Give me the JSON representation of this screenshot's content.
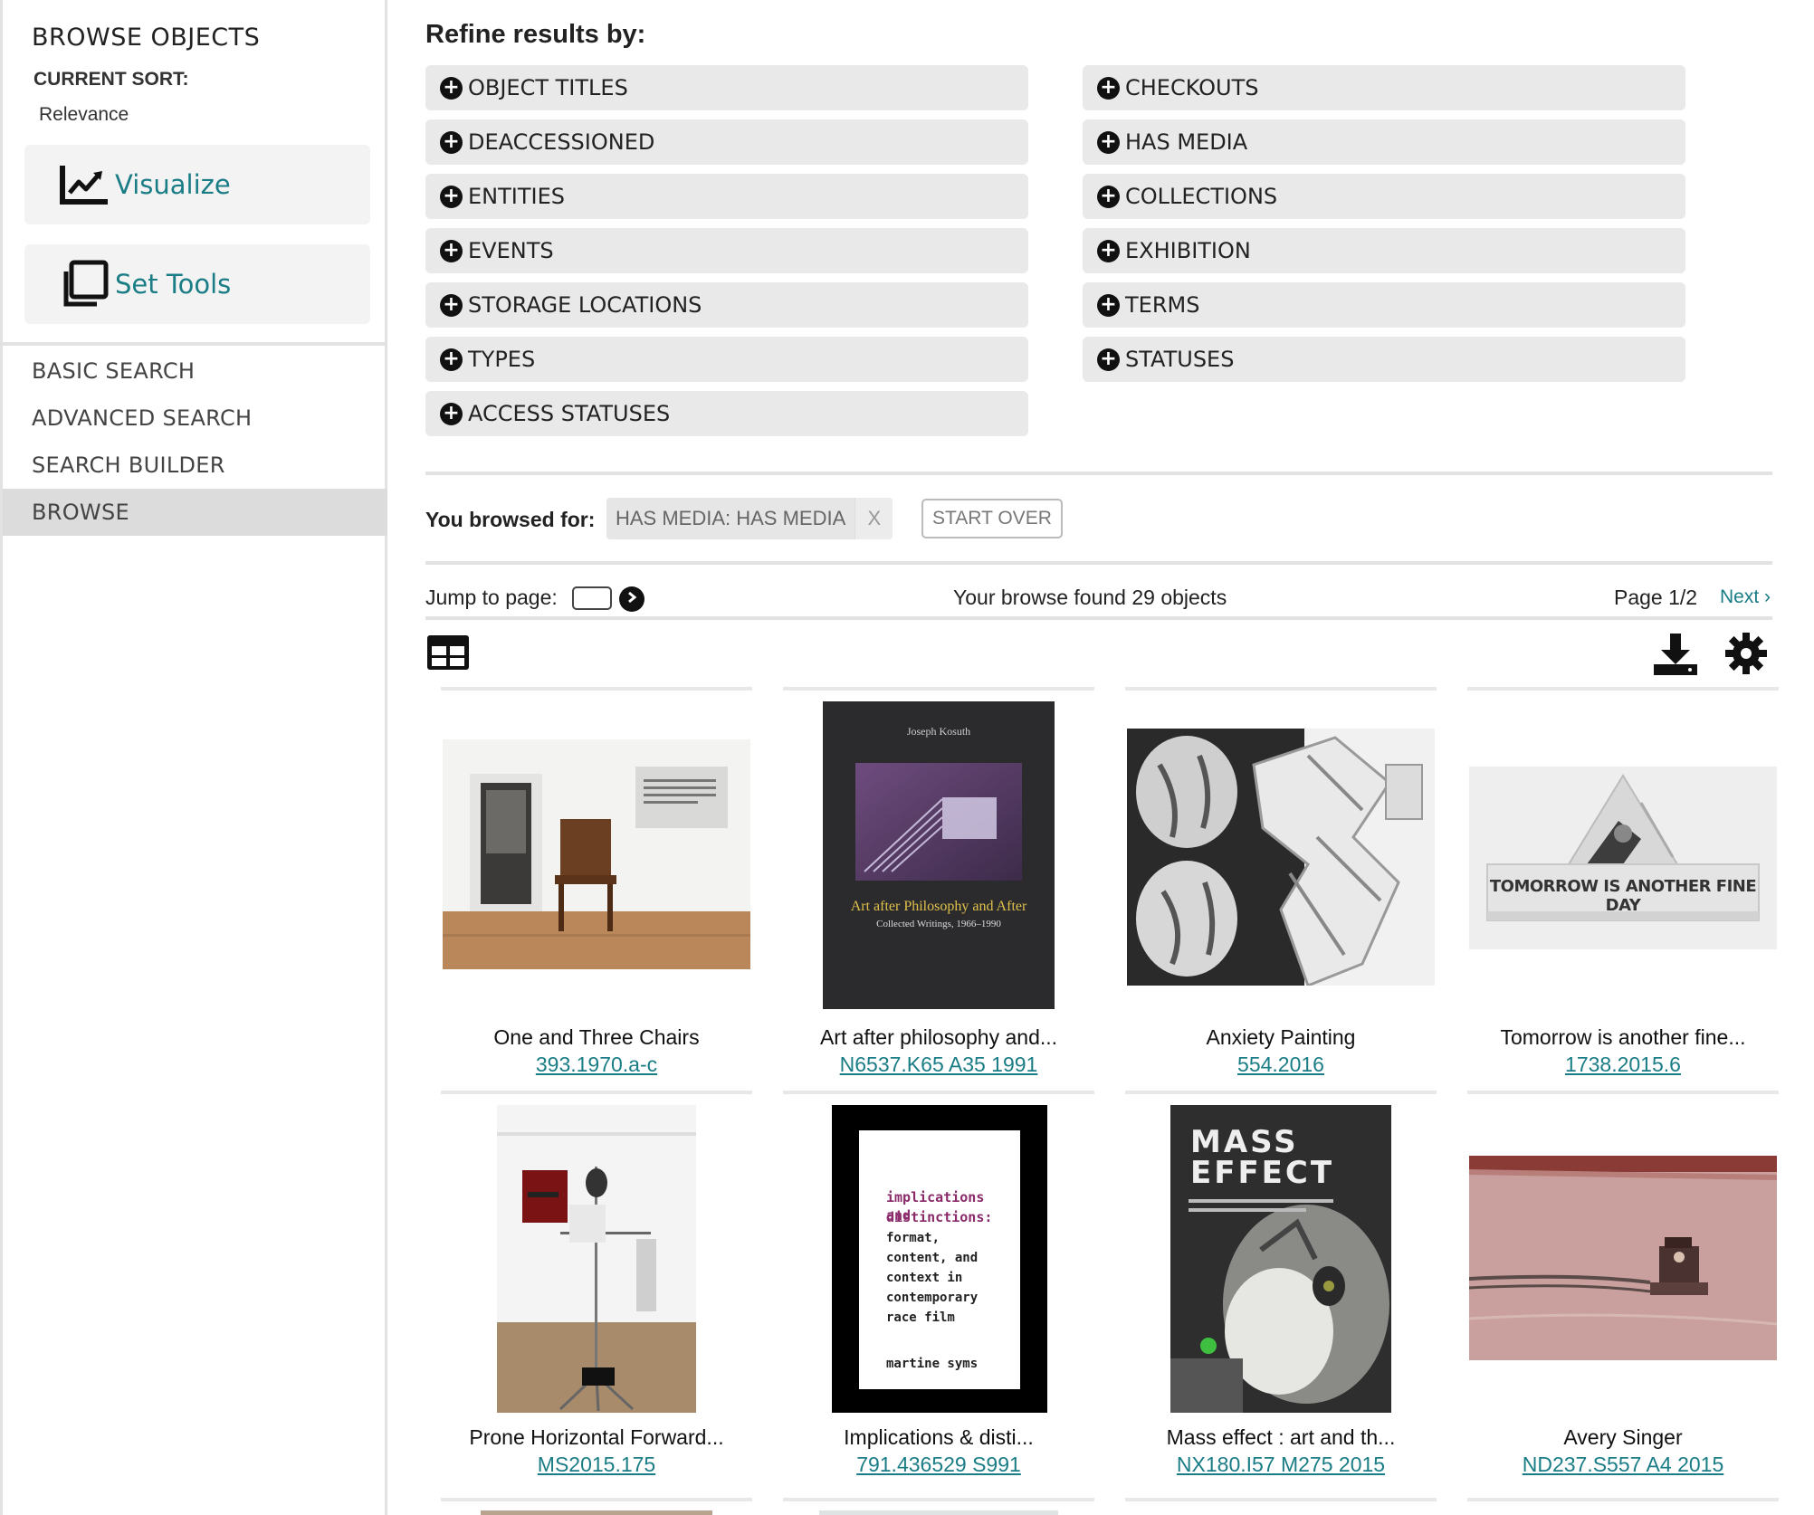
{
  "sidebar": {
    "title": "BROWSE OBJECTS",
    "sort_label": "CURRENT SORT:",
    "sort_value": "Relevance",
    "tools": [
      {
        "label": "Visualize",
        "icon": "chart-line-icon"
      },
      {
        "label": "Set Tools",
        "icon": "copy-sets-icon"
      }
    ],
    "nav": [
      {
        "label": "BASIC SEARCH"
      },
      {
        "label": "ADVANCED SEARCH"
      },
      {
        "label": "SEARCH BUILDER"
      },
      {
        "label": "BROWSE",
        "active": true
      }
    ]
  },
  "refine": {
    "title": "Refine results by:",
    "left": [
      "OBJECT TITLES",
      "DEACCESSIONED",
      "ENTITIES",
      "EVENTS",
      "STORAGE LOCATIONS",
      "TYPES",
      "ACCESS STATUSES"
    ],
    "right": [
      "CHECKOUTS",
      "HAS MEDIA",
      "COLLECTIONS",
      "EXHIBITION",
      "TERMS",
      "STATUSES"
    ]
  },
  "browsed": {
    "label": "You browsed for:",
    "chip": "HAS MEDIA: HAS MEDIA",
    "chip_remove": "X",
    "start_over": "START OVER"
  },
  "pager": {
    "jump_label": "Jump to page:",
    "found": "Your browse found 29 objects",
    "page": "Page 1/2",
    "next": "Next ›"
  },
  "results": [
    {
      "title": "One and Three Chairs",
      "idno": "393.1970.a-c"
    },
    {
      "title": "Art after philosophy and...",
      "idno": "N6537.K65 A35 1991",
      "cover_author": "Joseph Kosuth",
      "cover_title": "Art after Philosophy and After",
      "cover_sub": "Collected Writings, 1966–1990"
    },
    {
      "title": "Anxiety Painting",
      "idno": "554.2016"
    },
    {
      "title": "Tomorrow is another fine...",
      "idno": "1738.2015.6",
      "headline": "TOMORROW IS ANOTHER FINE DAY"
    },
    {
      "title": "Prone Horizontal Forward...",
      "idno": "MS2015.175"
    },
    {
      "title": "Implications & disti...",
      "idno": "791.436529 S991",
      "cover_title1": "implications and",
      "cover_title2": "distinctions:",
      "cover_body": "format, content, and context in contemporary race film",
      "cover_author": "martine syms"
    },
    {
      "title": "Mass effect : art and th...",
      "idno": "NX180.I57 M275 2015",
      "cover_title": "MASS EFFECT"
    },
    {
      "title": "Avery Singer",
      "idno": "ND237.S557 A4 2015"
    }
  ]
}
